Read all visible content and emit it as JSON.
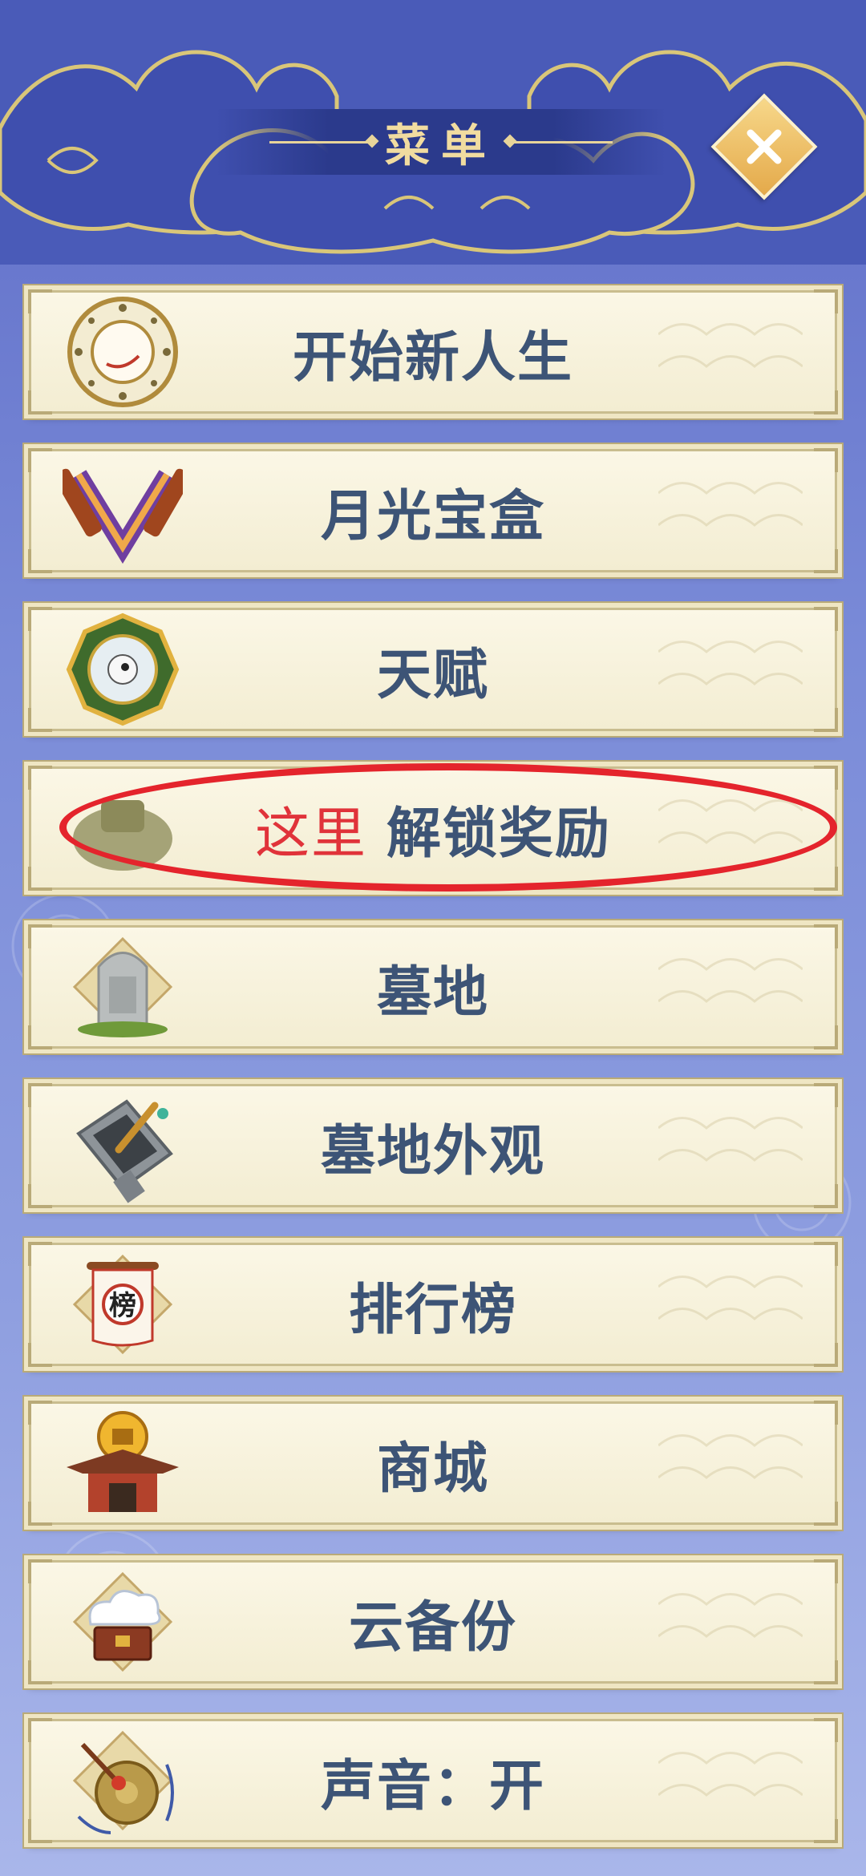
{
  "header": {
    "title": "菜单"
  },
  "menu": {
    "items": [
      {
        "label": "开始新人生",
        "icon": "zodiac-clock-icon"
      },
      {
        "label": "月光宝盒",
        "icon": "moonlight-box-icon"
      },
      {
        "label": "天赋",
        "icon": "bagua-icon"
      },
      {
        "hint": "这里",
        "label": "解锁奖励",
        "icon": "reward-pouch-icon"
      },
      {
        "label": "墓地",
        "icon": "tombstone-icon"
      },
      {
        "label": "墓地外观",
        "icon": "inkstone-brush-icon"
      },
      {
        "label": "排行榜",
        "icon": "ranking-scroll-icon"
      },
      {
        "label": "商城",
        "icon": "shop-pavilion-icon"
      },
      {
        "label": "云备份",
        "icon": "cloud-chest-icon"
      },
      {
        "label": "声音：开",
        "icon": "gong-icon"
      }
    ]
  },
  "colors": {
    "background": "#6f7fd2",
    "label": "#3d5476",
    "highlight": "#e4242c",
    "title": "#f1dca0"
  }
}
